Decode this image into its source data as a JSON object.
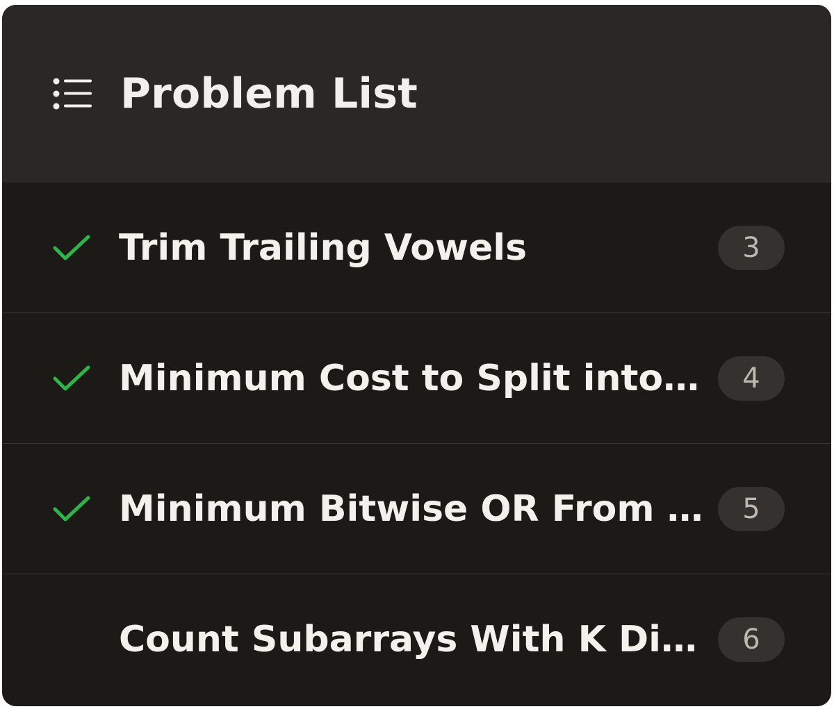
{
  "header": {
    "icon": "list-icon",
    "title": "Problem List"
  },
  "colors": {
    "panel_bg": "#1b1a17",
    "header_bg": "#2a2824",
    "check_green": "#2fb34a",
    "badge_bg": "#34322e",
    "text": "#f3f1ec"
  },
  "problems": [
    {
      "title": "Trim Trailing Vowels",
      "count": "3",
      "solved": true,
      "status_icon": "check-icon"
    },
    {
      "title": "Minimum Cost to Split into O...",
      "count": "4",
      "solved": true,
      "status_icon": "check-icon"
    },
    {
      "title": "Minimum Bitwise OR From Grid",
      "count": "5",
      "solved": true,
      "status_icon": "check-icon"
    },
    {
      "title": "Count Subarrays With K Disti...",
      "count": "6",
      "solved": false,
      "status_icon": ""
    }
  ]
}
